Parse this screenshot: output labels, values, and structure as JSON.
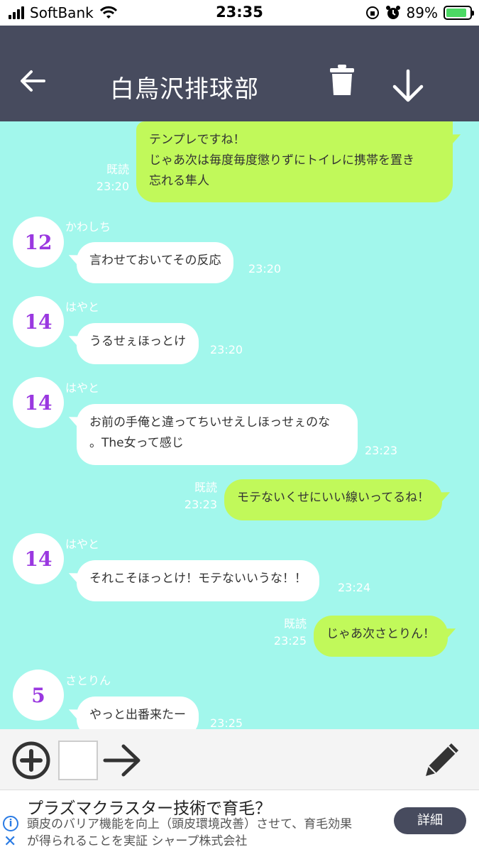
{
  "status_bar": {
    "carrier": "SoftBank",
    "time": "23:35",
    "battery": "89%"
  },
  "header": {
    "title": "白鳥沢排球部"
  },
  "messages": [
    {
      "text1": "テンプレですね！",
      "text2": "じゃあ次は毎度毎度懲りずにトイレに携帯を置き",
      "text3": "忘れる隼人",
      "read": "既読",
      "time": "23:20"
    },
    {
      "sender": "かわしち",
      "avatar": "12",
      "text": "言わせておいてその反応",
      "time": "23:20"
    },
    {
      "sender": "はやと",
      "avatar": "14",
      "text": "うるせぇほっとけ",
      "time": "23:20"
    },
    {
      "sender": "はやと",
      "avatar": "14",
      "text1": "お前の手俺と違ってちいせえしほっせぇのな",
      "text2": "。The女って感じ",
      "time": "23:23"
    },
    {
      "text": "モテないくせにいい線いってるね！",
      "read": "既読",
      "time": "23:23"
    },
    {
      "sender": "はやと",
      "avatar": "14",
      "text": "それこそほっとけ！モテないいうな！！",
      "time": "23:24"
    },
    {
      "text": "じゃあ次さとりん！",
      "read": "既読",
      "time": "23:25"
    },
    {
      "sender": "さとりん",
      "avatar": "5",
      "text": "やっと出番来たー",
      "time": "23:25"
    }
  ],
  "ad": {
    "headline": "プラズマクラスター技術で育毛？",
    "line1": "頭皮のバリア機能を向上（頭皮環境改善）させて、育毛効果",
    "line2": "が得られることを実証 シャープ株式会社",
    "button": "詳細"
  }
}
